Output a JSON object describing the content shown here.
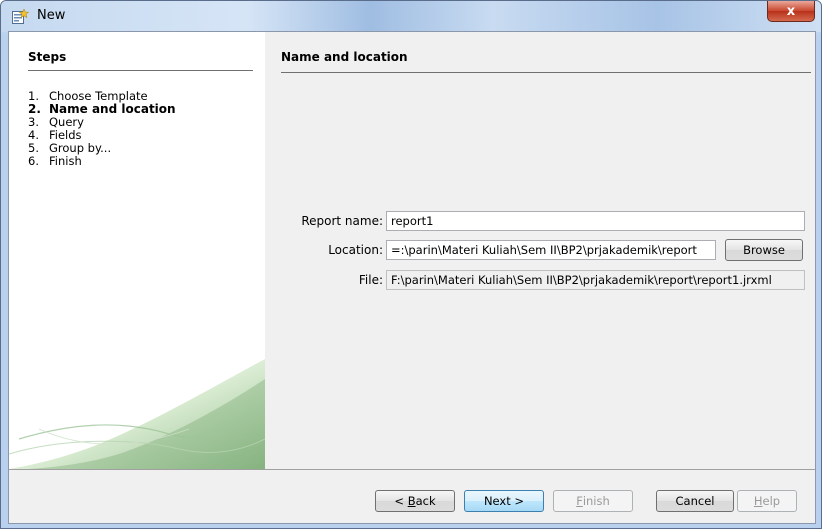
{
  "window": {
    "title": "New",
    "close_glyph": "x"
  },
  "steps": {
    "header": "Steps",
    "items": [
      {
        "num": "1.",
        "label": "Choose Template"
      },
      {
        "num": "2.",
        "label": "Name and location"
      },
      {
        "num": "3.",
        "label": "Query"
      },
      {
        "num": "4.",
        "label": "Fields"
      },
      {
        "num": "5.",
        "label": "Group by..."
      },
      {
        "num": "6.",
        "label": "Finish"
      }
    ],
    "active_index": 1
  },
  "panel": {
    "header": "Name and location",
    "report_name_label": "Report name:",
    "report_name_value": "report1",
    "location_label": "Location:",
    "location_value": "=:\\parin\\Materi Kuliah\\Sem II\\BP2\\prjakademik\\report",
    "browse_label": "Browse",
    "file_label": "File:",
    "file_value": "F:\\parin\\Materi Kuliah\\Sem II\\BP2\\prjakademik\\report\\report1.jrxml"
  },
  "buttons": {
    "back": {
      "prefix": "< ",
      "mnemonic": "B",
      "rest": "ack"
    },
    "next": "Next >",
    "finish": {
      "mnemonic": "F",
      "rest": "inish"
    },
    "cancel": "Cancel",
    "help": {
      "mnemonic": "H",
      "rest": "elp"
    }
  },
  "colors": {
    "accent": "#3c7fb1",
    "close": "#c8452c",
    "swoosh": "#8fbf8a"
  },
  "icons": {
    "app": "netbeans-new-icon",
    "close": "close-icon"
  }
}
